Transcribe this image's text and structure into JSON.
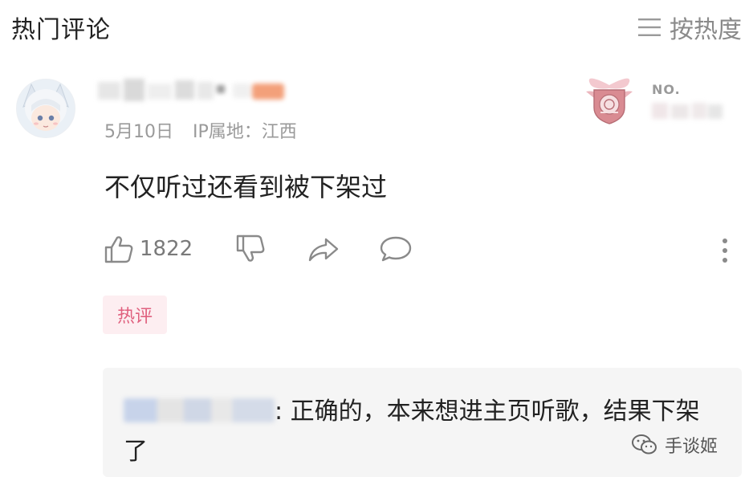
{
  "header": {
    "title": "热门评论",
    "sort_label": "按热度",
    "sort_icon": "menu-lines-icon"
  },
  "comment": {
    "date": "5月10日",
    "ip_location": "IP属地：江西",
    "badge_label": "NO.",
    "text": "不仅听过还看到被下架过",
    "like_count": "1822",
    "tag": "热评"
  },
  "reply": {
    "separator": ":",
    "text": "正确的，本来想进主页听歌，结果下架了"
  },
  "watermark": {
    "text": "手谈姬"
  },
  "colors": {
    "accent_pink": "#e0607e",
    "tag_bg": "#fdeef1",
    "gray_text": "#9a9a9a",
    "reply_bg": "#f5f5f5"
  }
}
